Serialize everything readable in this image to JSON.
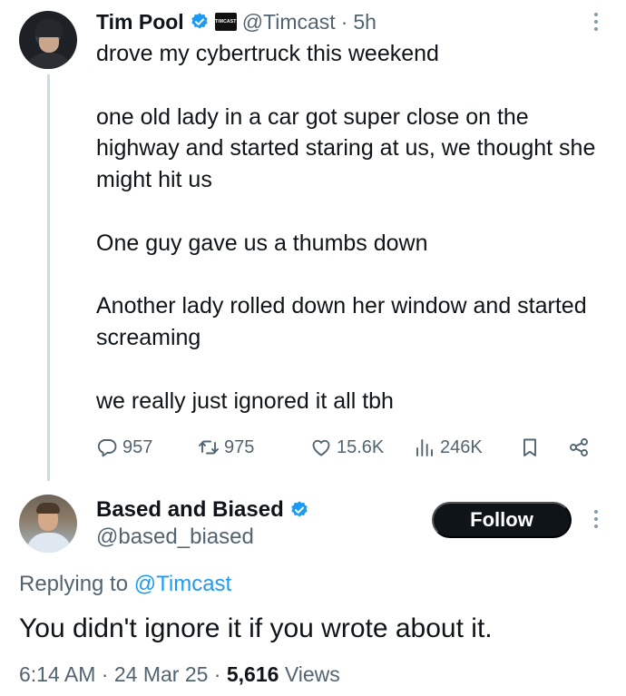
{
  "tweet": {
    "author": {
      "name": "Tim Pool",
      "handle": "@Timcast",
      "verified": true,
      "affiliate_badge": "TIMCAST"
    },
    "separator": "·",
    "time": "5h",
    "lines": [
      "drove my cybertruck this weekend",
      "one old lady in a car got super close on the highway and started staring at us, we thought she might hit us",
      "One guy gave us a thumbs down",
      "Another lady rolled down her window and started screaming",
      "we really just ignored it all tbh"
    ],
    "stats": {
      "replies": "957",
      "reposts": "975",
      "likes": "15.6K",
      "views": "246K"
    }
  },
  "reply": {
    "author": {
      "name": "Based and Biased",
      "handle": "@based_biased",
      "verified": true
    },
    "follow_label": "Follow",
    "replying_prefix": "Replying to",
    "replying_to": "@Timcast",
    "text": "You didn't ignore it if you wrote about it.",
    "time": "6:14 AM",
    "date": "24 Mar 25",
    "views_count": "5,616",
    "views_label": "Views"
  },
  "colors": {
    "text": "#0f1419",
    "secondary": "#536471",
    "verified": "#1d9bf0",
    "link": "#1d9bf0",
    "button": "#0f1419"
  },
  "icons": [
    "reply-icon",
    "repost-icon",
    "like-icon",
    "views-icon",
    "bookmark-icon",
    "share-icon",
    "more-icon",
    "verified-icon"
  ]
}
